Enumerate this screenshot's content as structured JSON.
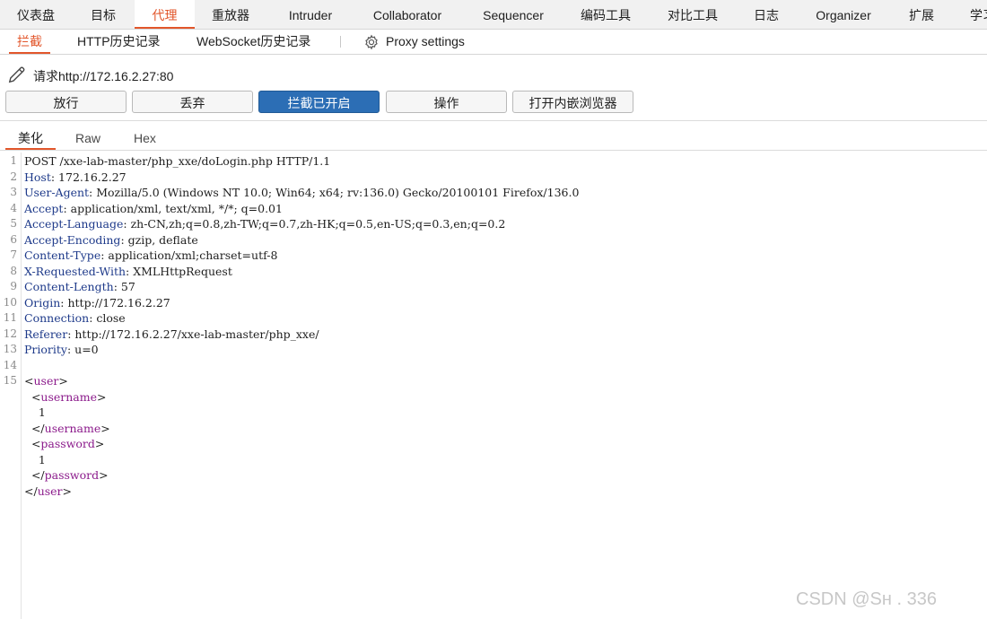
{
  "top_tabs": [
    {
      "label": "仪表盘"
    },
    {
      "label": "目标"
    },
    {
      "label": "代理"
    },
    {
      "label": "重放器"
    },
    {
      "label": "Intruder"
    },
    {
      "label": "Collaborator"
    },
    {
      "label": "Sequencer"
    },
    {
      "label": "编码工具"
    },
    {
      "label": "对比工具"
    },
    {
      "label": "日志"
    },
    {
      "label": "Organizer"
    },
    {
      "label": "扩展"
    },
    {
      "label": "学习"
    }
  ],
  "active_top_tab": "代理",
  "sub_tabs": [
    {
      "label": "拦截"
    },
    {
      "label": "HTTP历史记录"
    },
    {
      "label": "WebSocket历史记录"
    }
  ],
  "proxy_settings_label": "Proxy settings",
  "request_label": "请求http://172.16.2.27:80",
  "buttons": {
    "forward": "放行",
    "drop": "丢弃",
    "intercept": "拦截已开启",
    "action": "操作",
    "browser": "打开内嵌浏览器"
  },
  "view_tabs": [
    {
      "label": "美化"
    },
    {
      "label": "Raw"
    },
    {
      "label": "Hex"
    }
  ],
  "request_lines": [
    {
      "n": "1",
      "name": "",
      "value": "POST /xxe-lab-master/php_xxe/doLogin.php HTTP/1.1"
    },
    {
      "n": "2",
      "name": "Host",
      "value": ": 172.16.2.27"
    },
    {
      "n": "3",
      "name": "User-Agent",
      "value": ": Mozilla/5.0 (Windows NT 10.0; Win64; x64; rv:136.0) Gecko/20100101 Firefox/136.0"
    },
    {
      "n": "4",
      "name": "Accept",
      "value": ": application/xml, text/xml, */*; q=0.01"
    },
    {
      "n": "5",
      "name": "Accept-Language",
      "value": ": zh-CN,zh;q=0.8,zh-TW;q=0.7,zh-HK;q=0.5,en-US;q=0.3,en;q=0.2"
    },
    {
      "n": "6",
      "name": "Accept-Encoding",
      "value": ": gzip, deflate"
    },
    {
      "n": "7",
      "name": "Content-Type",
      "value": ": application/xml;charset=utf-8"
    },
    {
      "n": "8",
      "name": "X-Requested-With",
      "value": ": XMLHttpRequest"
    },
    {
      "n": "9",
      "name": "Content-Length",
      "value": ": 57"
    },
    {
      "n": "10",
      "name": "Origin",
      "value": ": http://172.16.2.27"
    },
    {
      "n": "11",
      "name": "Connection",
      "value": ": close"
    },
    {
      "n": "12",
      "name": "Referer",
      "value": ": http://172.16.2.27/xxe-lab-master/php_xxe/"
    },
    {
      "n": "13",
      "name": "Priority",
      "value": ": u=0"
    },
    {
      "n": "14",
      "name": "",
      "value": ""
    }
  ],
  "body_line_number": "15",
  "body_lines": [
    {
      "pre": "<",
      "tag": "user",
      "post": ">"
    },
    {
      "pre": "  <",
      "tag": "username",
      "post": ">"
    },
    {
      "pre": "    1",
      "tag": "",
      "post": ""
    },
    {
      "pre": "  </",
      "tag": "username",
      "post": ">"
    },
    {
      "pre": "  <",
      "tag": "password",
      "post": ">"
    },
    {
      "pre": "    1",
      "tag": "",
      "post": ""
    },
    {
      "pre": "  </",
      "tag": "password",
      "post": ">"
    },
    {
      "pre": "</",
      "tag": "user",
      "post": ">"
    }
  ],
  "watermark": "CSDN @Sн    . 336"
}
